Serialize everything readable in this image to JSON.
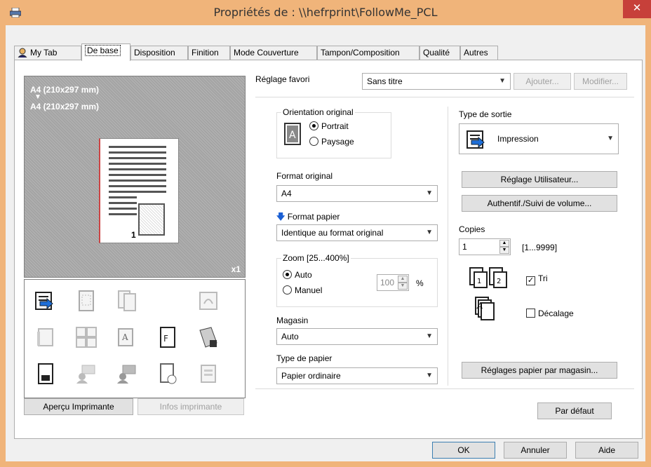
{
  "window": {
    "title": "Propriétés de : \\\\hefrprint\\FollowMe_PCL",
    "close_label": "✕",
    "accent": "#f0b47a"
  },
  "tabs": [
    {
      "label": "My Tab"
    },
    {
      "label": "De base"
    },
    {
      "label": "Disposition"
    },
    {
      "label": "Finition"
    },
    {
      "label": "Mode Couverture"
    },
    {
      "label": "Tampon/Composition"
    },
    {
      "label": "Qualité"
    },
    {
      "label": "Autres"
    }
  ],
  "preview": {
    "orig_size": "A4 (210x297 mm)",
    "arrow": "▼",
    "out_size": "A4 (210x297 mm)",
    "page_number": "1",
    "copies_badge": "x1"
  },
  "left_buttons": {
    "apercu": "Aperçu Imprimante",
    "infos": "Infos imprimante"
  },
  "favorite": {
    "label": "Réglage favori",
    "value": "Sans titre",
    "add": "Ajouter...",
    "modify": "Modifier..."
  },
  "orientation": {
    "title": "Orientation original",
    "portrait": "Portrait",
    "paysage": "Paysage",
    "selected": "Portrait"
  },
  "format_original": {
    "label": "Format original",
    "value": "A4"
  },
  "format_papier": {
    "label": "Format papier",
    "value": "Identique au format original"
  },
  "zoom": {
    "title": "Zoom [25...400%]",
    "auto": "Auto",
    "manuel": "Manuel",
    "value": "100",
    "unit": "%"
  },
  "magasin": {
    "label": "Magasin",
    "value": "Auto"
  },
  "type_papier": {
    "label": "Type de papier",
    "value": "Papier ordinaire"
  },
  "sortie": {
    "label": "Type de sortie",
    "value": "Impression"
  },
  "right_buttons": {
    "reglage_utilisateur": "Réglage Utilisateur...",
    "authentif": "Authentif./Suivi de volume...",
    "reglages_papier": "Réglages papier par magasin..."
  },
  "copies": {
    "label": "Copies",
    "value": "1",
    "range": "[1...9999]",
    "tri": "Tri",
    "tri_checked": true,
    "decalage": "Décalage",
    "decalage_checked": false
  },
  "par_defaut": "Par défaut",
  "footer": {
    "ok": "OK",
    "annuler": "Annuler",
    "aide": "Aide"
  }
}
